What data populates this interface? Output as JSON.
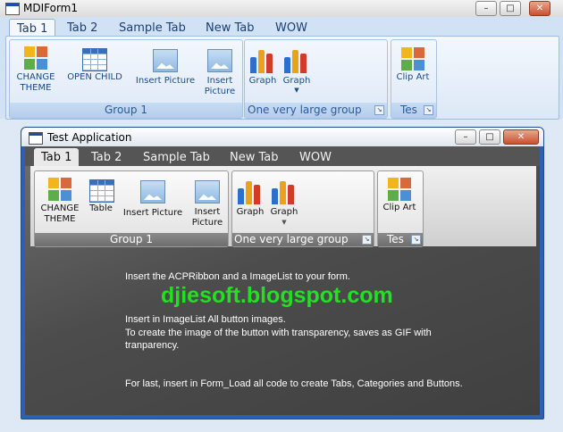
{
  "outer": {
    "title": "MDIForm1",
    "controls": {
      "minimize": "–",
      "maximize": "□",
      "close": "✕"
    },
    "tabs": [
      "Tab 1",
      "Tab 2",
      "Sample Tab",
      "New Tab",
      "WOW"
    ],
    "buttons": {
      "change_theme": "CHANGE\nTHEME",
      "open_child": "OPEN CHILD",
      "insert_picture": "Insert Picture",
      "insert_picture2": "Insert\nPicture",
      "graph1": "Graph",
      "graph2": "Graph",
      "clip_art": "Clip Art"
    },
    "groups": [
      "Group 1",
      "One very large group",
      "Tes"
    ]
  },
  "child": {
    "title": "Test Application",
    "controls": {
      "minimize": "–",
      "maximize": "□",
      "close": "✕"
    },
    "tabs": [
      "Tab 1",
      "Tab 2",
      "Sample Tab",
      "New Tab",
      "WOW"
    ],
    "buttons": {
      "change_theme": "CHANGE\nTHEME",
      "table": "Table",
      "insert_picture": "Insert Picture",
      "insert_picture2": "Insert\nPicture",
      "graph1": "Graph",
      "graph2": "Graph",
      "clip_art": "Clip Art"
    },
    "groups": [
      "Group 1",
      "One very large group",
      "Tes"
    ],
    "body": {
      "line1": "Insert the ACPRibbon and a ImageList to your form.",
      "watermark": "djiesoft.blogspot.com",
      "line2": "Insert in ImageList All button images.",
      "line3": "To create the image of the button with transparency, saves as GIF with tranparency.",
      "line4": "For last, insert in Form_Load all code to create Tabs, Categories and Buttons."
    }
  },
  "colors": {
    "outer_tab_text": "#1b3f74",
    "child_frame": "#2f5fb4",
    "watermark": "#22e022",
    "close_button": "#c9502e"
  }
}
